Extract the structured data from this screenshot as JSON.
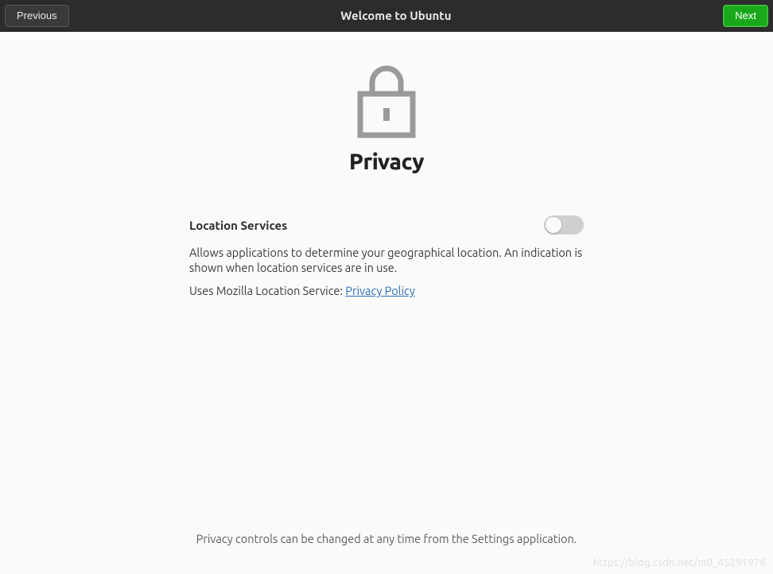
{
  "header": {
    "title": "Welcome to Ubuntu",
    "previous_label": "Previous",
    "next_label": "Next"
  },
  "main": {
    "page_heading": "Privacy",
    "section": {
      "title": "Location Services",
      "toggle_on": false,
      "description": "Allows applications to determine your geographical location. An indication is shown when location services are in use.",
      "uses_prefix": "Uses Mozilla Location Service: ",
      "privacy_link_label": "Privacy Policy"
    },
    "footer_note": "Privacy controls can be changed at any time from the Settings application."
  },
  "watermark": "https://blog.csdn.net/m0_45291976"
}
